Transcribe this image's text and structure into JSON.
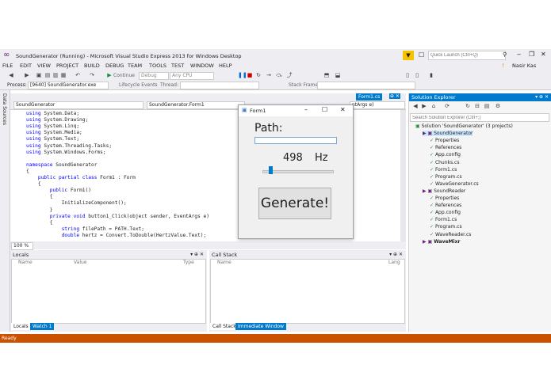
{
  "window": {
    "title": "SoundGenerator (Running) - Microsoft Visual Studio Express 2013 for Windows Desktop",
    "quick_launch_placeholder": "Quick Launch (Ctrl+Q)",
    "user": "Nasir Kas"
  },
  "menu": [
    "FILE",
    "EDIT",
    "VIEW",
    "PROJECT",
    "BUILD",
    "DEBUG",
    "TEAM",
    "TOOLS",
    "TEST",
    "WINDOW",
    "HELP"
  ],
  "toolbar": {
    "continue_label": "Continue",
    "config": "Debug",
    "platform": "Any CPU",
    "process_label": "Process:",
    "process_value": "[9640] SoundGenerator.exe",
    "lifecycle": "Lifecycle Events",
    "thread_label": "Thread:",
    "stack_frame_label": "Stack Frame:"
  },
  "side_tab": "Data Sources",
  "editor": {
    "tab_name": "Form1.cs",
    "nav_left": "SoundGenerator",
    "nav_mid": "SoundGenerator.Form1",
    "nav_right": "ntArgs e)",
    "zoom": "100 %",
    "lines": [
      {
        "p": "using ",
        "r": "System.Data;"
      },
      {
        "p": "using ",
        "r": "System.Drawing;"
      },
      {
        "p": "using ",
        "r": "System.Linq;"
      },
      {
        "p": "using ",
        "r": "System.Media;"
      },
      {
        "p": "using ",
        "r": "System.Text;"
      },
      {
        "p": "using ",
        "r": "System.Threading.Tasks;"
      },
      {
        "p": "using ",
        "r": "System.Windows.Forms;"
      },
      {
        "p": "",
        "r": ""
      },
      {
        "p": "namespace ",
        "r": "SoundGenerator"
      },
      {
        "p": "",
        "r": "{"
      },
      {
        "p": "    public partial class ",
        "r": "Form1 : Form"
      },
      {
        "p": "",
        "r": "    {"
      },
      {
        "p": "        public ",
        "r": "Form1()"
      },
      {
        "p": "",
        "r": "        {"
      },
      {
        "p": "",
        "r": "            InitializeComponent();"
      },
      {
        "p": "",
        "r": "        }"
      },
      {
        "p": "        private void ",
        "r": "button1_Click(object sender, EventArgs e)"
      },
      {
        "p": "",
        "r": "        {"
      },
      {
        "p": "            string ",
        "r": "filePath = PATH.Text;"
      },
      {
        "p": "            double ",
        "r": "hertz = Convert.ToDouble(HertzValue.Text);"
      }
    ]
  },
  "locals": {
    "title": "Locals",
    "cols": [
      "Name",
      "Value",
      "Type"
    ],
    "tabs": [
      "Locals",
      "Watch 1"
    ]
  },
  "callstack": {
    "title": "Call Stack",
    "cols": [
      "Name",
      "Lang"
    ],
    "tabs": [
      "Call Stack",
      "Immediate Window"
    ]
  },
  "solution_explorer": {
    "title": "Solution Explorer",
    "search_placeholder": "Search Solution Explorer (Ctrl+;)",
    "items": [
      {
        "t": "Solution 'SoundGenerator' (3 projects)",
        "d": 0
      },
      {
        "t": "SoundGenerator",
        "d": 1
      },
      {
        "t": "Properties",
        "d": 2
      },
      {
        "t": "References",
        "d": 2
      },
      {
        "t": "App.config",
        "d": 2
      },
      {
        "t": "Chunks.cs",
        "d": 2
      },
      {
        "t": "Form1.cs",
        "d": 2
      },
      {
        "t": "Program.cs",
        "d": 2
      },
      {
        "t": "WaveGenerator.cs",
        "d": 2
      },
      {
        "t": "SoundReader",
        "d": 1
      },
      {
        "t": "Properties",
        "d": 2
      },
      {
        "t": "References",
        "d": 2
      },
      {
        "t": "App.config",
        "d": 2
      },
      {
        "t": "Form1.cs",
        "d": 2
      },
      {
        "t": "Program.cs",
        "d": 2
      },
      {
        "t": "WaveReader.cs",
        "d": 2
      },
      {
        "t": "WaveMixr",
        "d": 1
      }
    ]
  },
  "form1": {
    "title": "Form1",
    "path_label": "Path:",
    "hertz_value": "498",
    "hertz_unit": "Hz",
    "slider_value": 0.1,
    "button": "Generate!"
  },
  "status": "Ready",
  "colors": {
    "accent": "#ca5100",
    "keyword": "#0000ff",
    "type": "#2b91af"
  }
}
